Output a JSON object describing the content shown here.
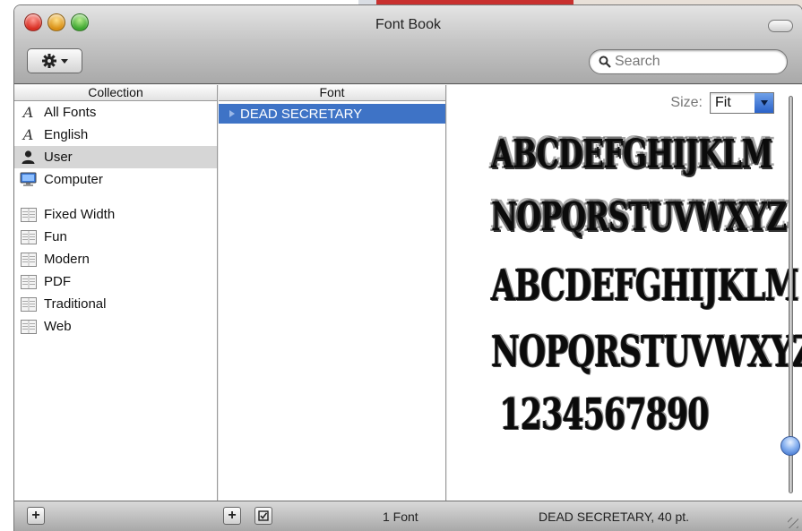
{
  "window": {
    "title": "Font Book"
  },
  "toolbar": {
    "action_icon": "gear-icon",
    "search_placeholder": "Search",
    "search_value": ""
  },
  "collection": {
    "header": "Collection",
    "items": [
      {
        "label": "All Fonts",
        "icon": "font-a-icon"
      },
      {
        "label": "English",
        "icon": "font-a-icon"
      },
      {
        "label": "User",
        "icon": "user-icon",
        "selected": true
      },
      {
        "label": "Computer",
        "icon": "computer-icon"
      }
    ],
    "groups": [
      {
        "label": "Fixed Width",
        "icon": "book-icon"
      },
      {
        "label": "Fun",
        "icon": "book-icon"
      },
      {
        "label": "Modern",
        "icon": "book-icon"
      },
      {
        "label": "PDF",
        "icon": "book-icon"
      },
      {
        "label": "Traditional",
        "icon": "book-icon"
      },
      {
        "label": "Web",
        "icon": "book-icon"
      }
    ]
  },
  "font": {
    "header": "Font",
    "items": [
      {
        "label": "DEAD SECRETARY",
        "selected": true
      }
    ]
  },
  "preview": {
    "size_label": "Size:",
    "size_value": "Fit",
    "sample_lines": [
      "ABCDEFGHIJKLM",
      "NOPQRSTUVWXYZ",
      "ABCDEFGHIJKLM",
      "NOPQRSTUVWXYZ",
      "1234567890"
    ],
    "size_slider_level": 0.1
  },
  "status": {
    "font_count": "1 Font",
    "selection": "DEAD SECRETARY, 40 pt."
  },
  "colors": {
    "selection": "#3e73c6",
    "accent": "#2f66c7"
  }
}
